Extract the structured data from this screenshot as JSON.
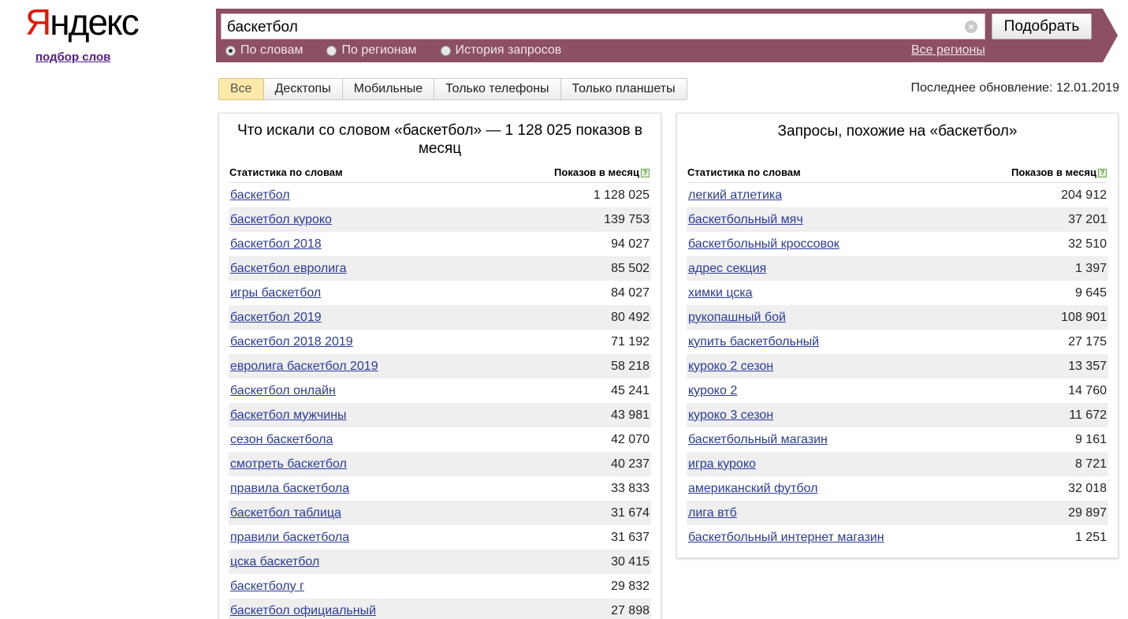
{
  "logo": {
    "first_letter": "Я",
    "rest": "ндекс"
  },
  "subtitle": "подбор слов",
  "search": {
    "query": "баскетбол",
    "submit_label": "Подобрать",
    "modes": [
      {
        "label": "По словам",
        "checked": true
      },
      {
        "label": "По регионам",
        "checked": false
      },
      {
        "label": "История запросов",
        "checked": false
      }
    ],
    "regions_link": "Все регионы"
  },
  "tabs": [
    {
      "label": "Все",
      "active": true
    },
    {
      "label": "Десктопы",
      "active": false
    },
    {
      "label": "Мобильные",
      "active": false
    },
    {
      "label": "Только телефоны",
      "active": false
    },
    {
      "label": "Только планшеты",
      "active": false
    }
  ],
  "last_update": "Последнее обновление: 12.01.2019",
  "left_panel": {
    "title": "Что искали со словом «баскетбол» — 1 128 025 показов в месяц",
    "col_phrase": "Статистика по словам",
    "col_count": "Показов в месяц",
    "rows": [
      {
        "phrase": "баскетбол",
        "count": "1 128 025"
      },
      {
        "phrase": "баскетбол куроко",
        "count": "139 753"
      },
      {
        "phrase": "баскетбол 2018",
        "count": "94 027"
      },
      {
        "phrase": "баскетбол евролига",
        "count": "85 502"
      },
      {
        "phrase": "игры баскетбол",
        "count": "84 027"
      },
      {
        "phrase": "баскетбол 2019",
        "count": "80 492"
      },
      {
        "phrase": "баскетбол 2018 2019",
        "count": "71 192"
      },
      {
        "phrase": "евролига баскетбол 2019",
        "count": "58 218"
      },
      {
        "phrase": "баскетбол онлайн",
        "count": "45 241"
      },
      {
        "phrase": "баскетбол мужчины",
        "count": "43 981"
      },
      {
        "phrase": "сезон баскетбола",
        "count": "42 070"
      },
      {
        "phrase": "смотреть баскетбол",
        "count": "40 237"
      },
      {
        "phrase": "правила баскетбола",
        "count": "33 833"
      },
      {
        "phrase": "баскетбол таблица",
        "count": "31 674"
      },
      {
        "phrase": "правили баскетбола",
        "count": "31 637"
      },
      {
        "phrase": "цска баскетбол",
        "count": "30 415"
      },
      {
        "phrase": "баскетболу г",
        "count": "29 832"
      },
      {
        "phrase": "баскетбол официальный",
        "count": "27 898"
      }
    ]
  },
  "right_panel": {
    "title": "Запросы, похожие на «баскетбол»",
    "col_phrase": "Статистика по словам",
    "col_count": "Показов в месяц",
    "rows": [
      {
        "phrase": "легкий атлетика",
        "count": "204 912"
      },
      {
        "phrase": "баскетбольный мяч",
        "count": "37 201"
      },
      {
        "phrase": "баскетбольный кроссовок",
        "count": "32 510"
      },
      {
        "phrase": "адрес секция",
        "count": "1 397"
      },
      {
        "phrase": "химки цска",
        "count": "9 645"
      },
      {
        "phrase": "рукопашный бой",
        "count": "108 901"
      },
      {
        "phrase": "купить баскетбольный",
        "count": "27 175"
      },
      {
        "phrase": "куроко 2 сезон",
        "count": "13 357"
      },
      {
        "phrase": "куроко 2",
        "count": "14 760"
      },
      {
        "phrase": "куроко 3 сезон",
        "count": "11 672"
      },
      {
        "phrase": "баскетбольный магазин",
        "count": "9 161"
      },
      {
        "phrase": "игра куроко",
        "count": "8 721"
      },
      {
        "phrase": "американский футбол",
        "count": "32 018"
      },
      {
        "phrase": "лига втб",
        "count": "29 897"
      },
      {
        "phrase": "баскетбольный интернет магазин",
        "count": "1 251"
      }
    ]
  },
  "colors": {
    "band": "#8c4f63",
    "link": "#2a3b9c",
    "logo_red": "#e61400",
    "active_tab": "#fde9a8"
  }
}
